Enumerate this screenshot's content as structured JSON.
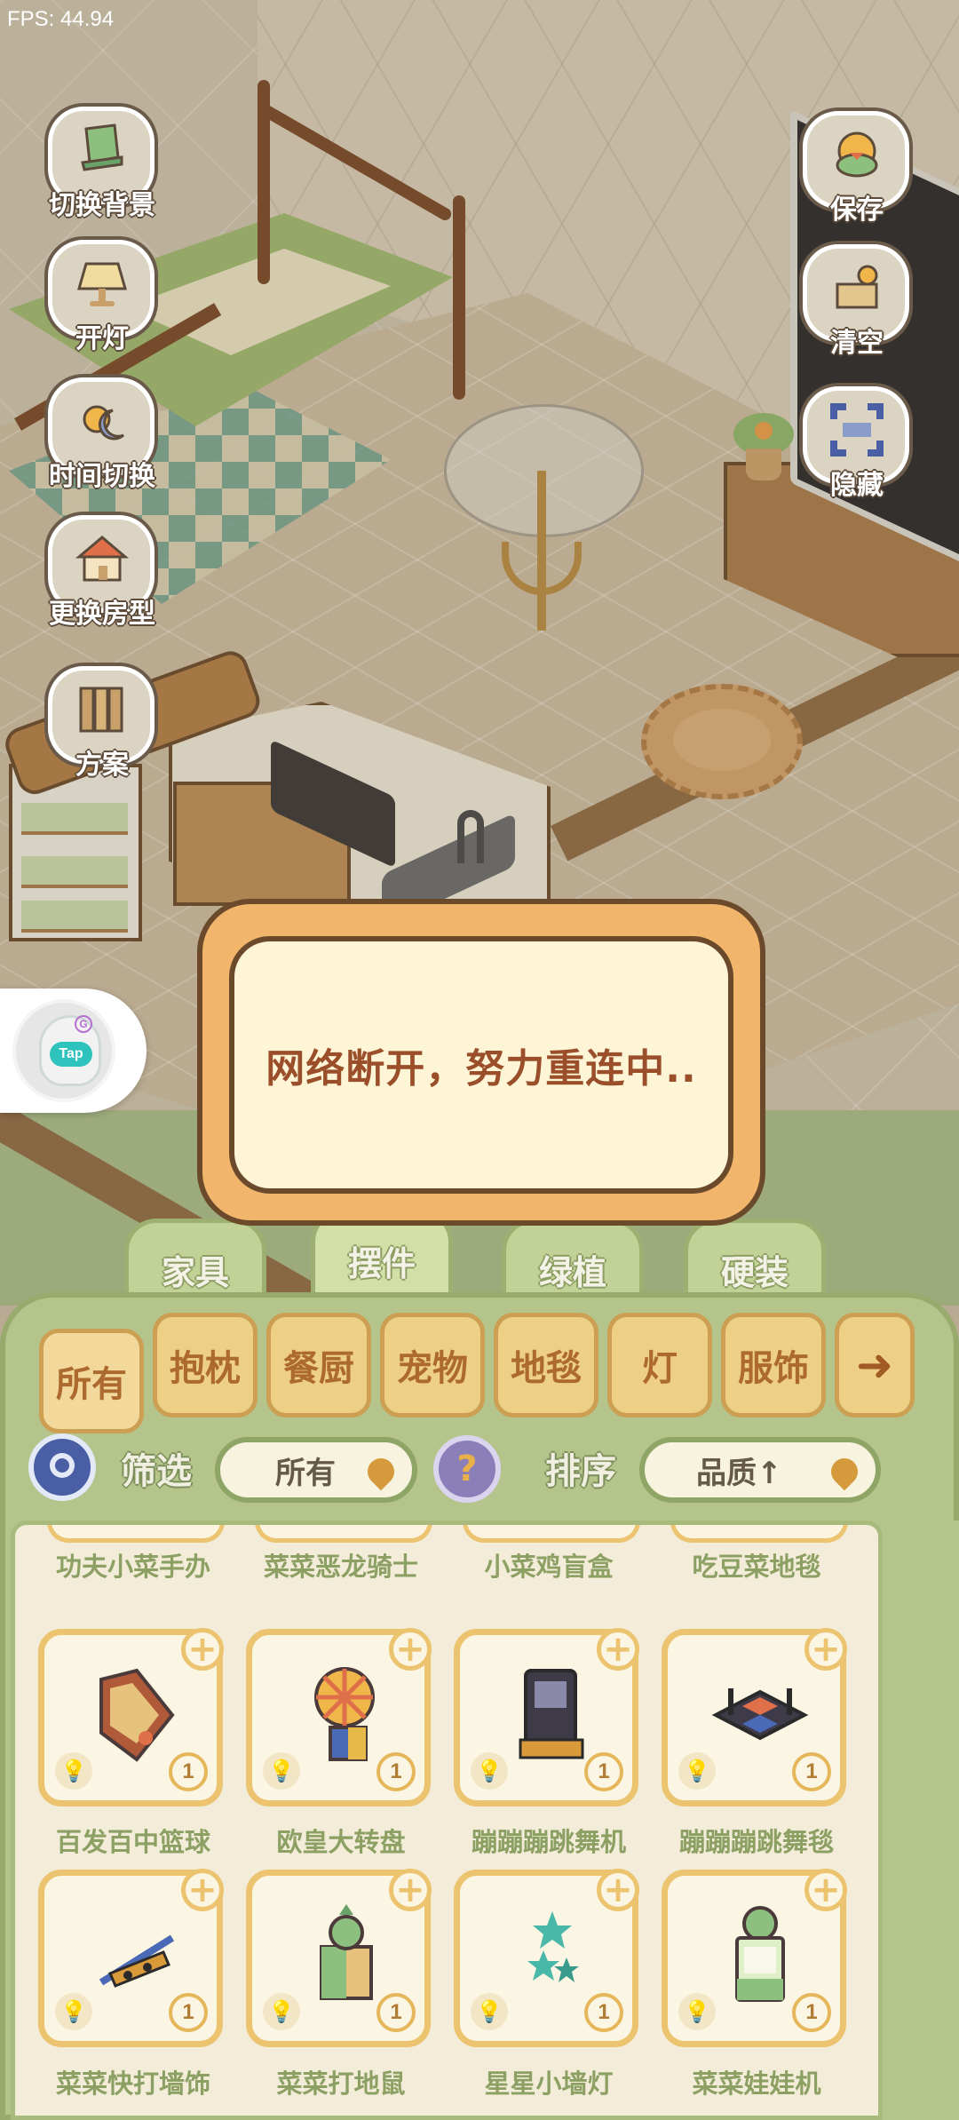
{
  "fps": "FPS: 44.94",
  "side_buttons_left": [
    {
      "name": "switch-background-button",
      "icon": "chair-icon",
      "label": "切换背景"
    },
    {
      "name": "light-on-button",
      "icon": "lamp-icon",
      "label": "开灯"
    },
    {
      "name": "time-switch-button",
      "icon": "sun-moon-icon",
      "label": "时间切换"
    },
    {
      "name": "change-house-type-button",
      "icon": "house-icon",
      "label": "更换房型"
    },
    {
      "name": "plan-button",
      "icon": "books-icon",
      "label": "方案"
    }
  ],
  "side_buttons_right": [
    {
      "name": "save-button",
      "icon": "duck-icon",
      "label": "保存"
    },
    {
      "name": "clear-button",
      "icon": "broom-icon",
      "label": "清空"
    },
    {
      "name": "hide-button",
      "icon": "frame-icon",
      "label": "隐藏"
    }
  ],
  "tap_widget": {
    "badge": "G",
    "label": "Tap"
  },
  "dialog": {
    "message": "网络断开，努力重连中.."
  },
  "category_tabs": [
    "家具",
    "摆件",
    "绿植",
    "硬装"
  ],
  "active_category": "摆件",
  "sub_tabs": [
    "所有",
    "抱枕",
    "餐厨",
    "宠物",
    "地毯",
    "灯",
    "服饰"
  ],
  "sub_tab_arrow": "➜",
  "active_sub_tab": "所有",
  "filter": {
    "label": "筛选",
    "value": "所有",
    "help": "?"
  },
  "sort": {
    "label": "排序",
    "value": "品质↑"
  },
  "top_row_names": [
    "功夫小菜手办",
    "菜菜恶龙骑士",
    "小菜鸡盲盒",
    "吃豆菜地毯"
  ],
  "items": [
    {
      "name": "百发百中篮球",
      "count": "1",
      "art": "basketball-machine-icon"
    },
    {
      "name": "欧皇大转盘",
      "count": "1",
      "art": "prize-wheel-icon"
    },
    {
      "name": "蹦蹦蹦跳舞机",
      "count": "1",
      "art": "dance-machine-icon"
    },
    {
      "name": "蹦蹦蹦跳舞毯",
      "count": "1",
      "art": "dance-mat-icon"
    },
    {
      "name": "菜菜快打墙饰",
      "count": "1",
      "art": "wall-decor-icon"
    },
    {
      "name": "菜菜打地鼠",
      "count": "1",
      "art": "whack-a-mole-icon"
    },
    {
      "name": "星星小墙灯",
      "count": "1",
      "art": "star-wall-lamp-icon"
    },
    {
      "name": "菜菜娃娃机",
      "count": "1",
      "art": "claw-machine-icon"
    }
  ],
  "colors": {
    "dialog_frame": "#f1b66b",
    "dialog_inner": "#fef5d7",
    "dialog_text": "#9a4f2a",
    "panel_green": "#b4c48a",
    "card_border": "#ecc36f",
    "item_name": "#8da064"
  }
}
